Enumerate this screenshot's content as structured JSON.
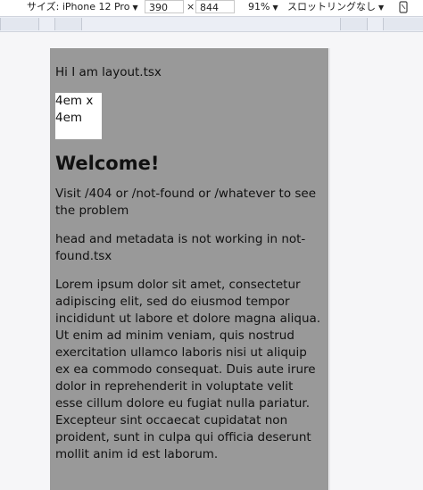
{
  "toolbar": {
    "size_label": "サイズ: iPhone 12 Pro",
    "width_value": "390",
    "times": "×",
    "height_value": "844",
    "zoom": "91%",
    "throttle": "スロットリングなし",
    "caret": "▼",
    "rotate_icon": "rotate-device-icon"
  },
  "page": {
    "layout_text": "Hi I am layout.tsx",
    "box_line1": "4em x",
    "box_line2": "4em",
    "heading": "Welcome!",
    "para1": "Visit /404 or /not-found or /whatever to see the problem",
    "para2": "head and metadata is not working in not-found.tsx",
    "para3": "Lorem ipsum dolor sit amet, consectetur adipiscing elit, sed do eiusmod tempor incididunt ut labore et dolore magna aliqua. Ut enim ad minim veniam, quis nostrud exercitation ullamco laboris nisi ut aliquip ex ea commodo consequat. Duis aute irure dolor in reprehenderit in voluptate velit esse cillum dolore eu fugiat nulla pariatur. Excepteur sint occaecat cupidatat non proident, sunt in culpa qui officia deserunt mollit anim id est laborum."
  },
  "colors": {
    "viewport_bg": "#999999",
    "box_bg": "#ffffff"
  }
}
